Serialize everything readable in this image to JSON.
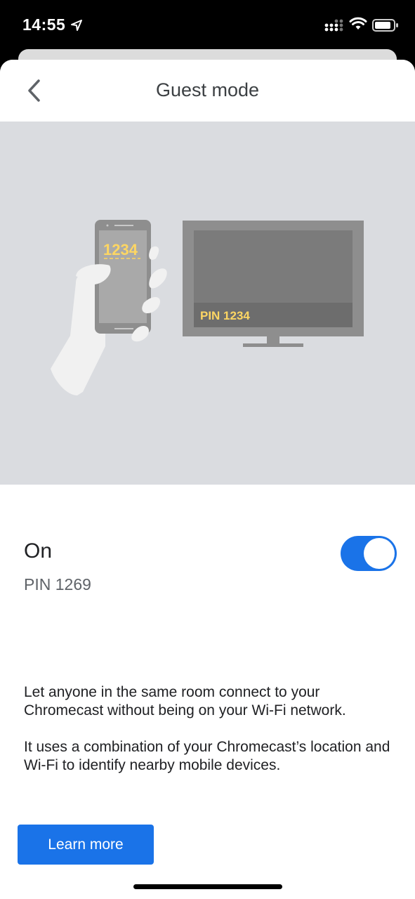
{
  "status_bar": {
    "time": "14:55",
    "icons": [
      "location-arrow-icon",
      "signal-icon",
      "wifi-icon",
      "battery-icon"
    ]
  },
  "header": {
    "title": "Guest mode",
    "back_icon": "chevron-left-icon"
  },
  "illustration": {
    "phone_pin": "1234",
    "tv_pin": "PIN 1234"
  },
  "settings": {
    "state_label": "On",
    "toggle_on": true,
    "pin": "PIN 1269",
    "description_1": "Let anyone in the same room connect to your Chromecast without being on your Wi-Fi network.",
    "description_2": "It uses a combination of your Chromecast’s location and Wi-Fi to identify nearby mobile devices.",
    "learn_more_label": "Learn more"
  },
  "colors": {
    "accent": "#1a73e8",
    "illustration_bg": "#dadce0",
    "pin_yellow": "#fdd663"
  }
}
